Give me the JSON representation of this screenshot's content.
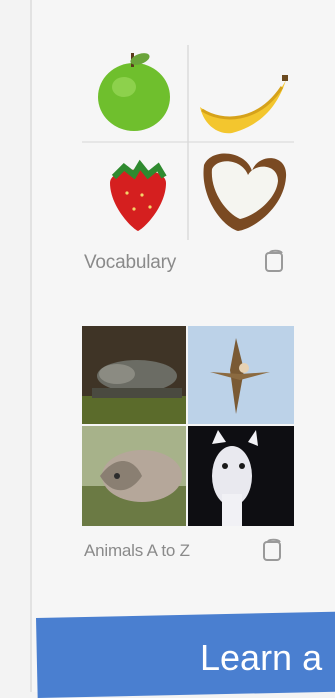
{
  "cards": [
    {
      "label": "Vocabulary",
      "icon": "copy-icon",
      "items": [
        "apple",
        "banana",
        "strawberry",
        "coconut"
      ]
    },
    {
      "label": "Animals A to Z",
      "icon": "copy-icon",
      "items": [
        "alligator",
        "bird",
        "armadillo",
        "alpaca"
      ]
    }
  ],
  "cta": {
    "label": "Learn a"
  },
  "colors": {
    "accent": "#4a7fd0",
    "label": "#8a8a8a"
  }
}
